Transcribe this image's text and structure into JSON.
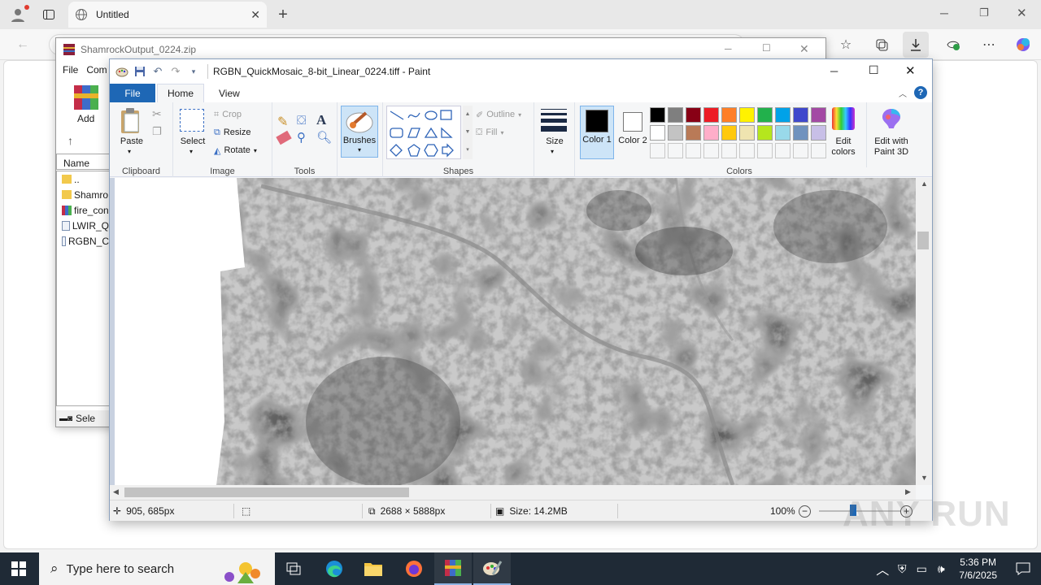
{
  "browser": {
    "tab_title": "Untitled",
    "new_tab_symbol": "+"
  },
  "winrar": {
    "title": "ShamrockOutput_0224.zip",
    "menu": [
      "File",
      "Com"
    ],
    "add_label": "Add",
    "list_header": "Name",
    "rows": [
      "..",
      "Shamro",
      "fire_con",
      "LWIR_Q",
      "RGBN_C"
    ],
    "status": "Sele"
  },
  "paint": {
    "title": "RGBN_QuickMosaic_8-bit_Linear_0224.tiff - Paint",
    "tabs": {
      "file": "File",
      "home": "Home",
      "view": "View"
    },
    "clipboard": {
      "paste": "Paste",
      "label": "Clipboard"
    },
    "image": {
      "select": "Select",
      "crop": "Crop",
      "resize": "Resize",
      "rotate": "Rotate",
      "label": "Image"
    },
    "tools": {
      "label": "Tools"
    },
    "brushes": {
      "label": "Brushes"
    },
    "shapes": {
      "outline": "Outline",
      "fill": "Fill",
      "label": "Shapes"
    },
    "size": {
      "label": "Size"
    },
    "color1": {
      "label": "Color 1",
      "value": "#000000"
    },
    "color2": {
      "label": "Color 2",
      "value": "#ffffff"
    },
    "colors": {
      "label": "Colors",
      "palette_row1": [
        "#000000",
        "#7f7f7f",
        "#880015",
        "#ed1c24",
        "#ff7f27",
        "#fff200",
        "#22b14c",
        "#00a2e8",
        "#3f48cc",
        "#a349a4"
      ],
      "palette_row2": [
        "#ffffff",
        "#c3c3c3",
        "#b97a57",
        "#ffaec9",
        "#ffc90e",
        "#efe4b0",
        "#b5e61d",
        "#99d9ea",
        "#7092be",
        "#c8bfe7"
      ],
      "edit_colors": "Edit colors"
    },
    "paint3d": "Edit with Paint 3D",
    "status": {
      "cursor": "905, 685px",
      "dimensions": "2688 × 5888px",
      "size": "Size: 14.2MB",
      "zoom": "100%"
    }
  },
  "taskbar": {
    "search_placeholder": "Type here to search",
    "time": "5:36 PM",
    "date": "7/6/2025"
  },
  "watermark": "ANY RUN"
}
